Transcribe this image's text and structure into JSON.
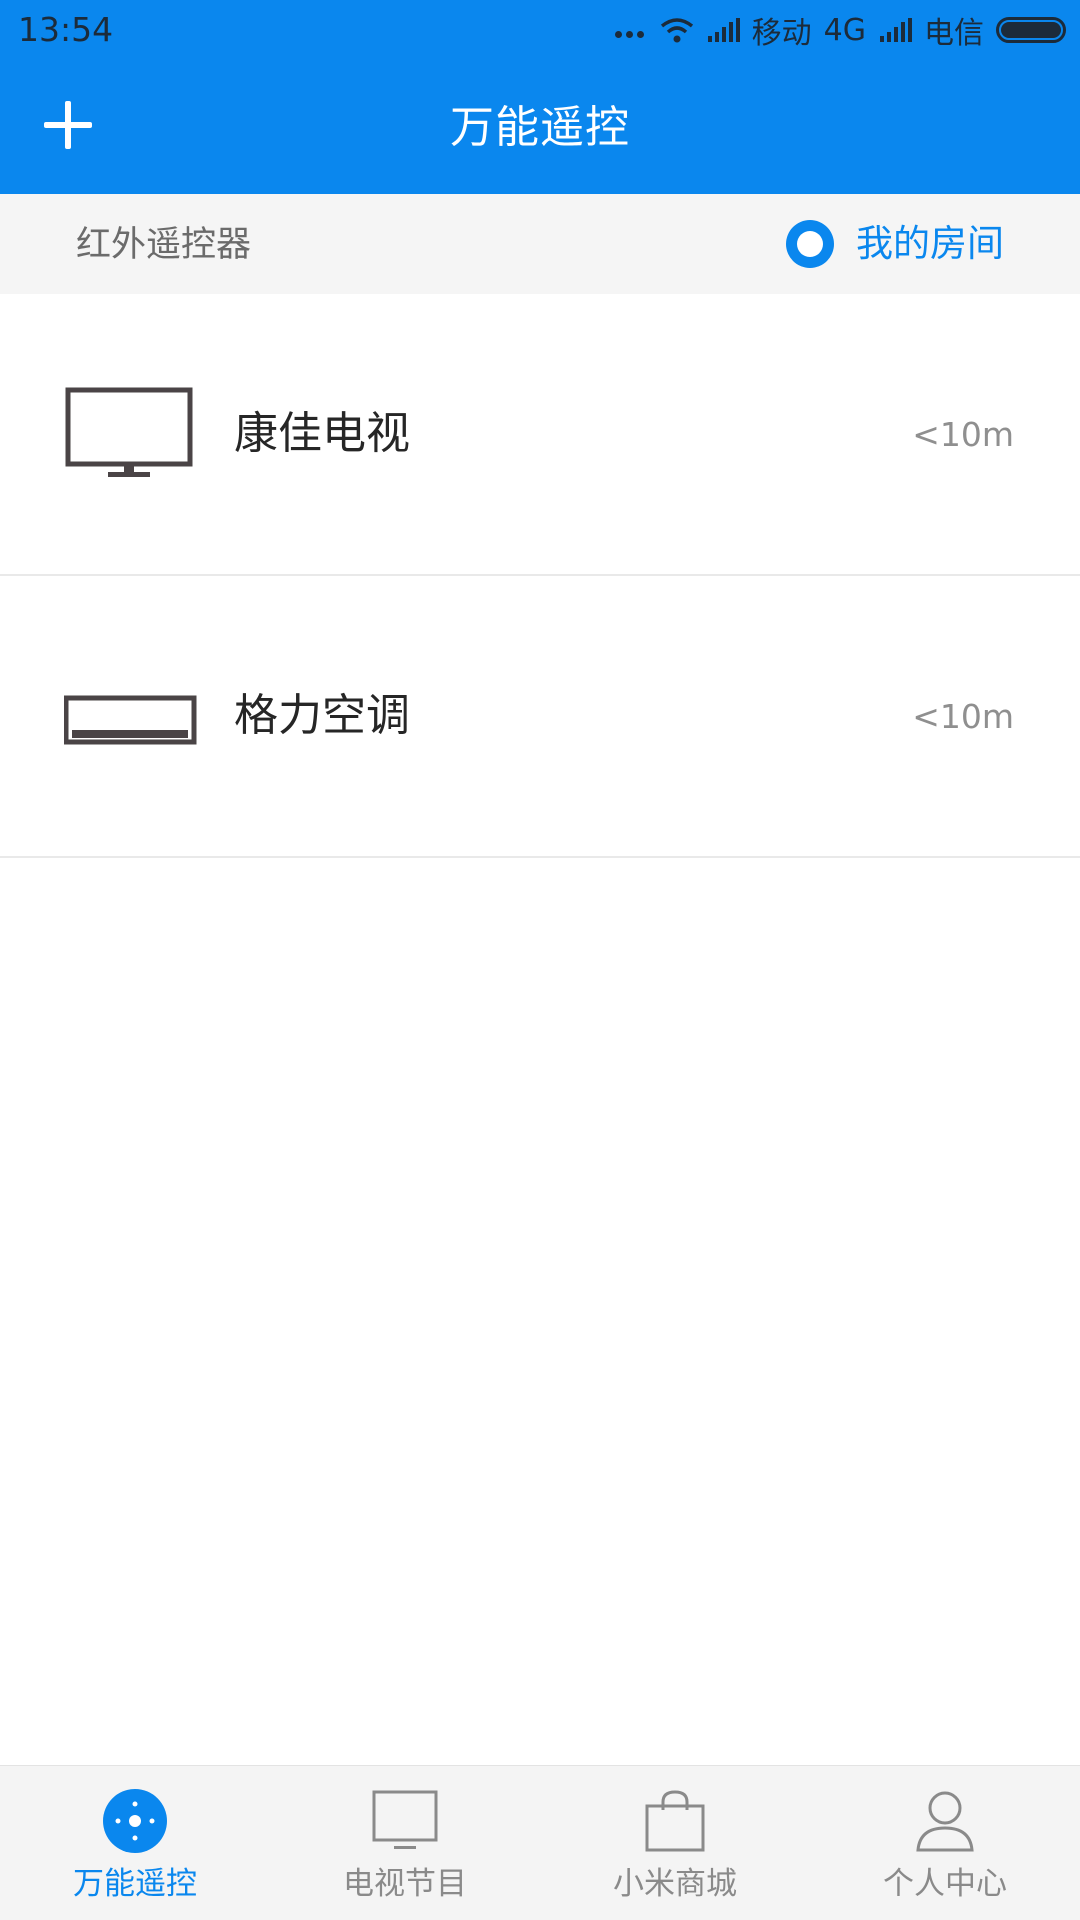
{
  "status_bar": {
    "time": "13:54",
    "carrier1": "移动",
    "network": "4G",
    "carrier2": "电信",
    "icons": [
      "more-dots-icon",
      "wifi-icon",
      "signal-icon",
      "signal-icon",
      "battery-icon"
    ]
  },
  "app_bar": {
    "title": "万能遥控",
    "add_icon": "plus-icon"
  },
  "section": {
    "title": "红外遥控器",
    "room_label": "我的房间",
    "room_icon": "room-ring-icon"
  },
  "devices": [
    {
      "name": "康佳电视",
      "distance": "<10m",
      "icon": "tv-icon"
    },
    {
      "name": "格力空调",
      "distance": "<10m",
      "icon": "air-conditioner-icon"
    }
  ],
  "bottom_nav": {
    "active_index": 0,
    "items": [
      {
        "label": "万能遥控",
        "icon": "remote-icon"
      },
      {
        "label": "电视节目",
        "icon": "tv-program-icon"
      },
      {
        "label": "小米商城",
        "icon": "shopping-bag-icon"
      },
      {
        "label": "个人中心",
        "icon": "person-icon"
      }
    ]
  },
  "colors": {
    "accent": "#0a87ee",
    "text_primary": "#262626",
    "text_secondary": "#8f8f8f",
    "section_bg": "#f5f5f5"
  }
}
